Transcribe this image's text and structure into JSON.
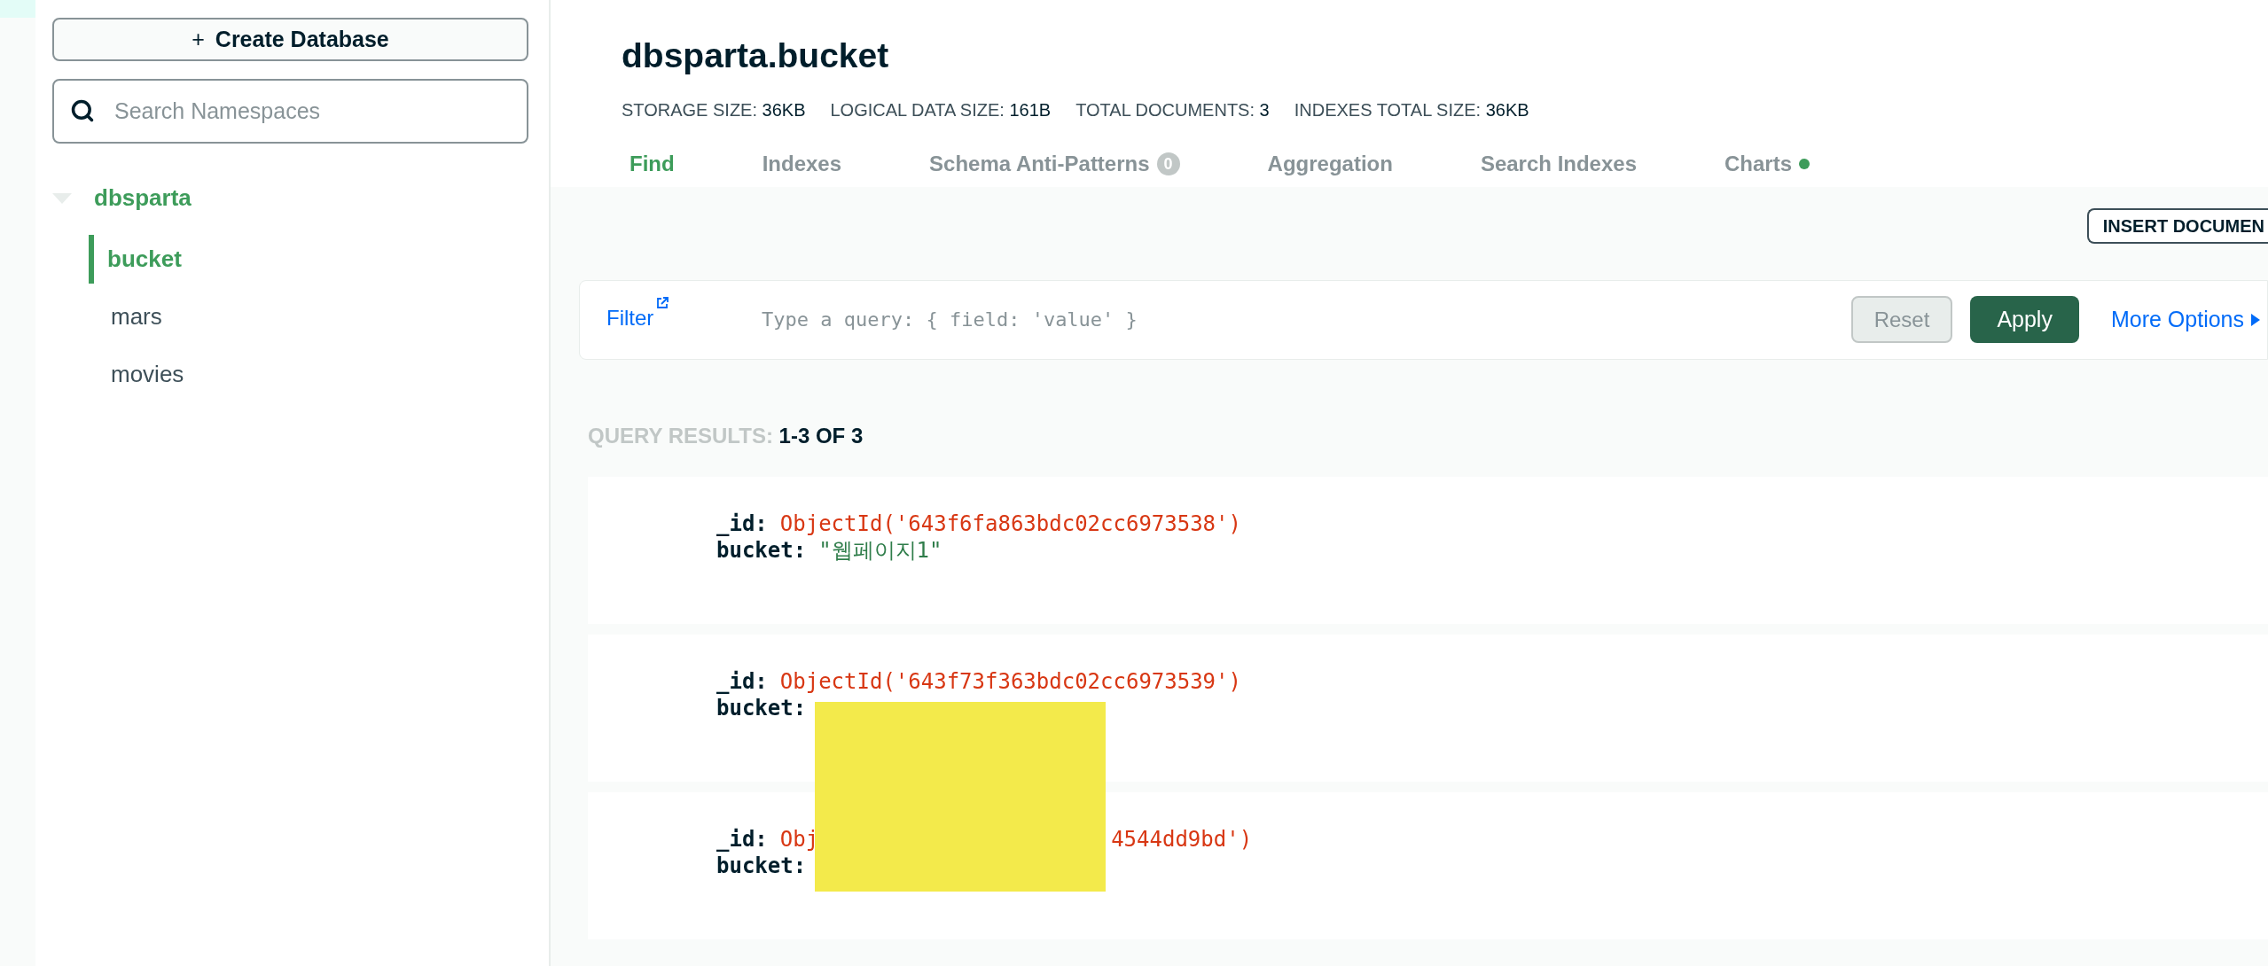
{
  "sidebar": {
    "create_button": {
      "icon": "+",
      "label": "Create Database"
    },
    "search": {
      "placeholder": "Search Namespaces"
    },
    "tree": [
      {
        "label": "dbsparta",
        "expanded": true,
        "children": [
          {
            "label": "bucket",
            "selected": true
          },
          {
            "label": "mars",
            "selected": false
          },
          {
            "label": "movies",
            "selected": false
          }
        ]
      }
    ]
  },
  "header": {
    "title": "dbsparta.bucket",
    "stats": [
      {
        "label": "STORAGE SIZE:",
        "value": "36KB"
      },
      {
        "label": "LOGICAL DATA SIZE:",
        "value": "161B"
      },
      {
        "label": "TOTAL DOCUMENTS:",
        "value": "3"
      },
      {
        "label": "INDEXES TOTAL SIZE:",
        "value": "36KB"
      }
    ],
    "tabs": [
      {
        "label": "Find",
        "selected": true
      },
      {
        "label": "Indexes",
        "selected": false
      },
      {
        "label": "Schema Anti-Patterns",
        "selected": false,
        "badge": "0"
      },
      {
        "label": "Aggregation",
        "selected": false
      },
      {
        "label": "Search Indexes",
        "selected": false
      },
      {
        "label": "Charts",
        "selected": false,
        "indicator": true
      }
    ]
  },
  "insert_button": "INSERT DOCUMEN",
  "filter": {
    "label": "Filter",
    "placeholder": "Type a query: { field: 'value' }",
    "reset": "Reset",
    "apply": "Apply",
    "more": "More Options"
  },
  "results": {
    "label": "QUERY RESULTS:",
    "count": "1-3 OF 3"
  },
  "documents": [
    {
      "fields": [
        {
          "key": "_id:",
          "value": "ObjectId('643f6fa863bdc02cc6973538')",
          "color": "#d83713"
        },
        {
          "key": "bucket:",
          "value": "\"웹페이지1\"",
          "color": "#2f7d4a"
        }
      ]
    },
    {
      "fields": [
        {
          "key": "_id:",
          "value": "ObjectId('643f73f363bdc02cc6973539')",
          "color": "#d83713"
        },
        {
          "key": "bucket:"
        }
      ]
    },
    {
      "fields": [
        {
          "key": "_id:",
          "value": "Obj",
          "value_tail": "4544dd9bd')",
          "color": "#d83713"
        },
        {
          "key": "bucket:"
        }
      ]
    }
  ]
}
